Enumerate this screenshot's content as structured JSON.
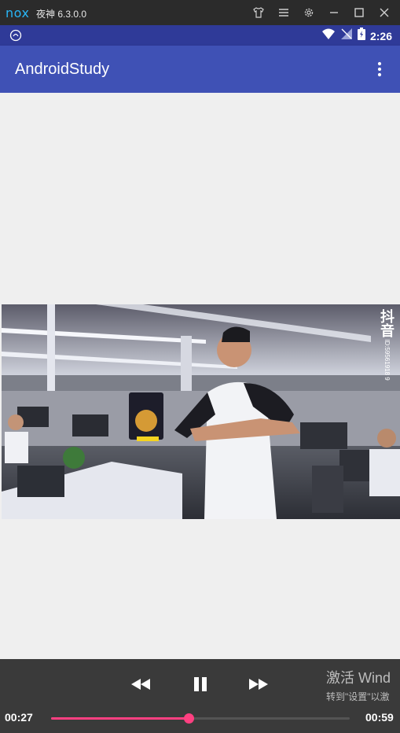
{
  "emulator": {
    "logo": "nox",
    "title": "夜神 6.3.0.0",
    "icons": [
      "shirt-icon",
      "menu-icon",
      "gear-icon",
      "minimize-icon",
      "maximize-icon",
      "close-icon"
    ]
  },
  "status_bar": {
    "time": "2:26",
    "icons": [
      "nox-notification-icon",
      "wifi-icon",
      "no-signal-icon",
      "battery-charging-icon"
    ]
  },
  "app_bar": {
    "title": "AndroidStudy",
    "menu_icon": "overflow-menu-icon",
    "color": "#3f51b5"
  },
  "video": {
    "watermark_brand": "抖音",
    "watermark_id": "ID:59561918 9"
  },
  "player": {
    "current_time": "00:27",
    "total_time": "00:59",
    "progress_fraction": 0.46,
    "buttons": [
      "rewind-icon",
      "pause-icon",
      "fast-forward-icon"
    ],
    "accent": "#ff4081"
  },
  "windows_activation": {
    "title": "激活 Wind",
    "subtitle": "转到\"设置\"以激"
  }
}
